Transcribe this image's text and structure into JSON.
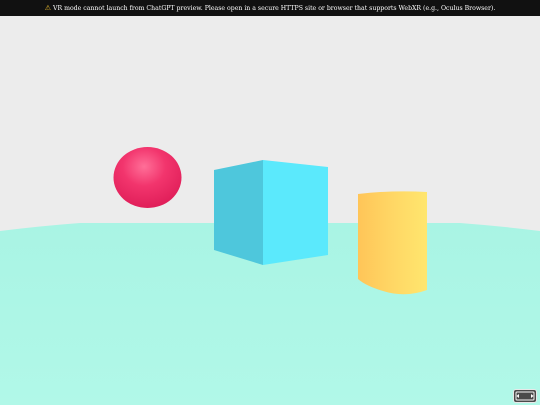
{
  "banner": {
    "icon": "warning-icon",
    "text": "VR mode cannot launch from ChatGPT preview. Please open in a secure HTTPS site or browser that supports WebXR (e.g., Oculus Browser)."
  },
  "scene": {
    "sky_color": "#ececec",
    "ground_color": "#adf6e6",
    "objects": [
      {
        "name": "sphere",
        "color": "#f0336e"
      },
      {
        "name": "box",
        "color": "#58e6fb"
      },
      {
        "name": "cylinder",
        "color": "#ffd860"
      }
    ]
  },
  "controls": {
    "vr_button_icon": "vr-headset-icon"
  }
}
